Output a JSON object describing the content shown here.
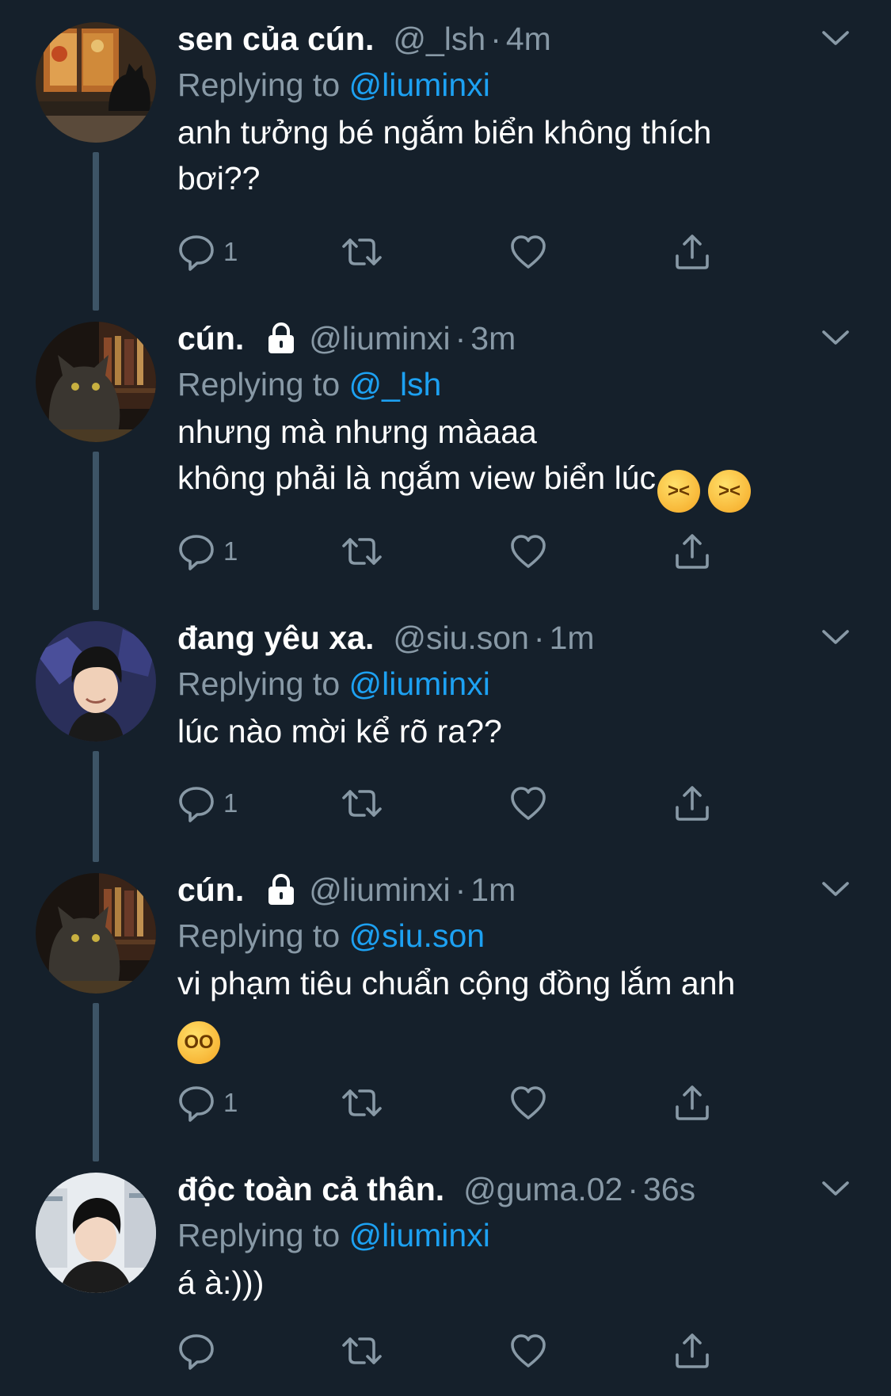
{
  "tweets": [
    {
      "name": "sen của cún.",
      "handle": "@_lsh",
      "time": "4m",
      "locked": false,
      "replying_prefix": "Replying to ",
      "replying_to": "@liuminxi",
      "lines": [
        "anh tưởng bé ngắm biển không thích",
        "bơi??"
      ],
      "reply_count": "1"
    },
    {
      "name": "cún.",
      "handle": "@liuminxi",
      "time": "3m",
      "locked": true,
      "replying_prefix": "Replying to ",
      "replying_to": "@_lsh",
      "lines": [
        "nhưng mà nhưng màaaa",
        "không phải là ngắm view biển lúc"
      ],
      "line_emojis": [
        "persevering-face",
        "persevering-face"
      ],
      "reply_count": "1"
    },
    {
      "name": "đang yêu xa.",
      "handle": "@siu.son",
      "time": "1m",
      "locked": false,
      "replying_prefix": "Replying to ",
      "replying_to": "@liuminxi",
      "lines": [
        "lúc nào mời kể rõ ra??"
      ],
      "reply_count": "1"
    },
    {
      "name": "cún.",
      "handle": "@liuminxi",
      "time": "1m",
      "locked": true,
      "replying_prefix": "Replying to ",
      "replying_to": "@siu.son",
      "lines": [
        "vi phạm tiêu chuẩn cộng đồng lắm anh"
      ],
      "trailing_emoji": "flushed-face",
      "reply_count": "1"
    },
    {
      "name": "độc toàn cả thân.",
      "handle": "@guma.02",
      "time": "36s",
      "locked": false,
      "replying_prefix": "Replying to ",
      "replying_to": "@liuminxi",
      "lines": [
        "á à:)))"
      ],
      "reply_count": ""
    }
  ],
  "separator": "·",
  "colors": {
    "background": "#15202b",
    "text": "#ffffff",
    "secondary": "#8899a6",
    "mention": "#1da1f2",
    "thread_line": "#3d5466"
  },
  "icons": [
    "reply-icon",
    "retweet-icon",
    "like-icon",
    "share-icon",
    "lock-icon",
    "caret-down-icon"
  ]
}
